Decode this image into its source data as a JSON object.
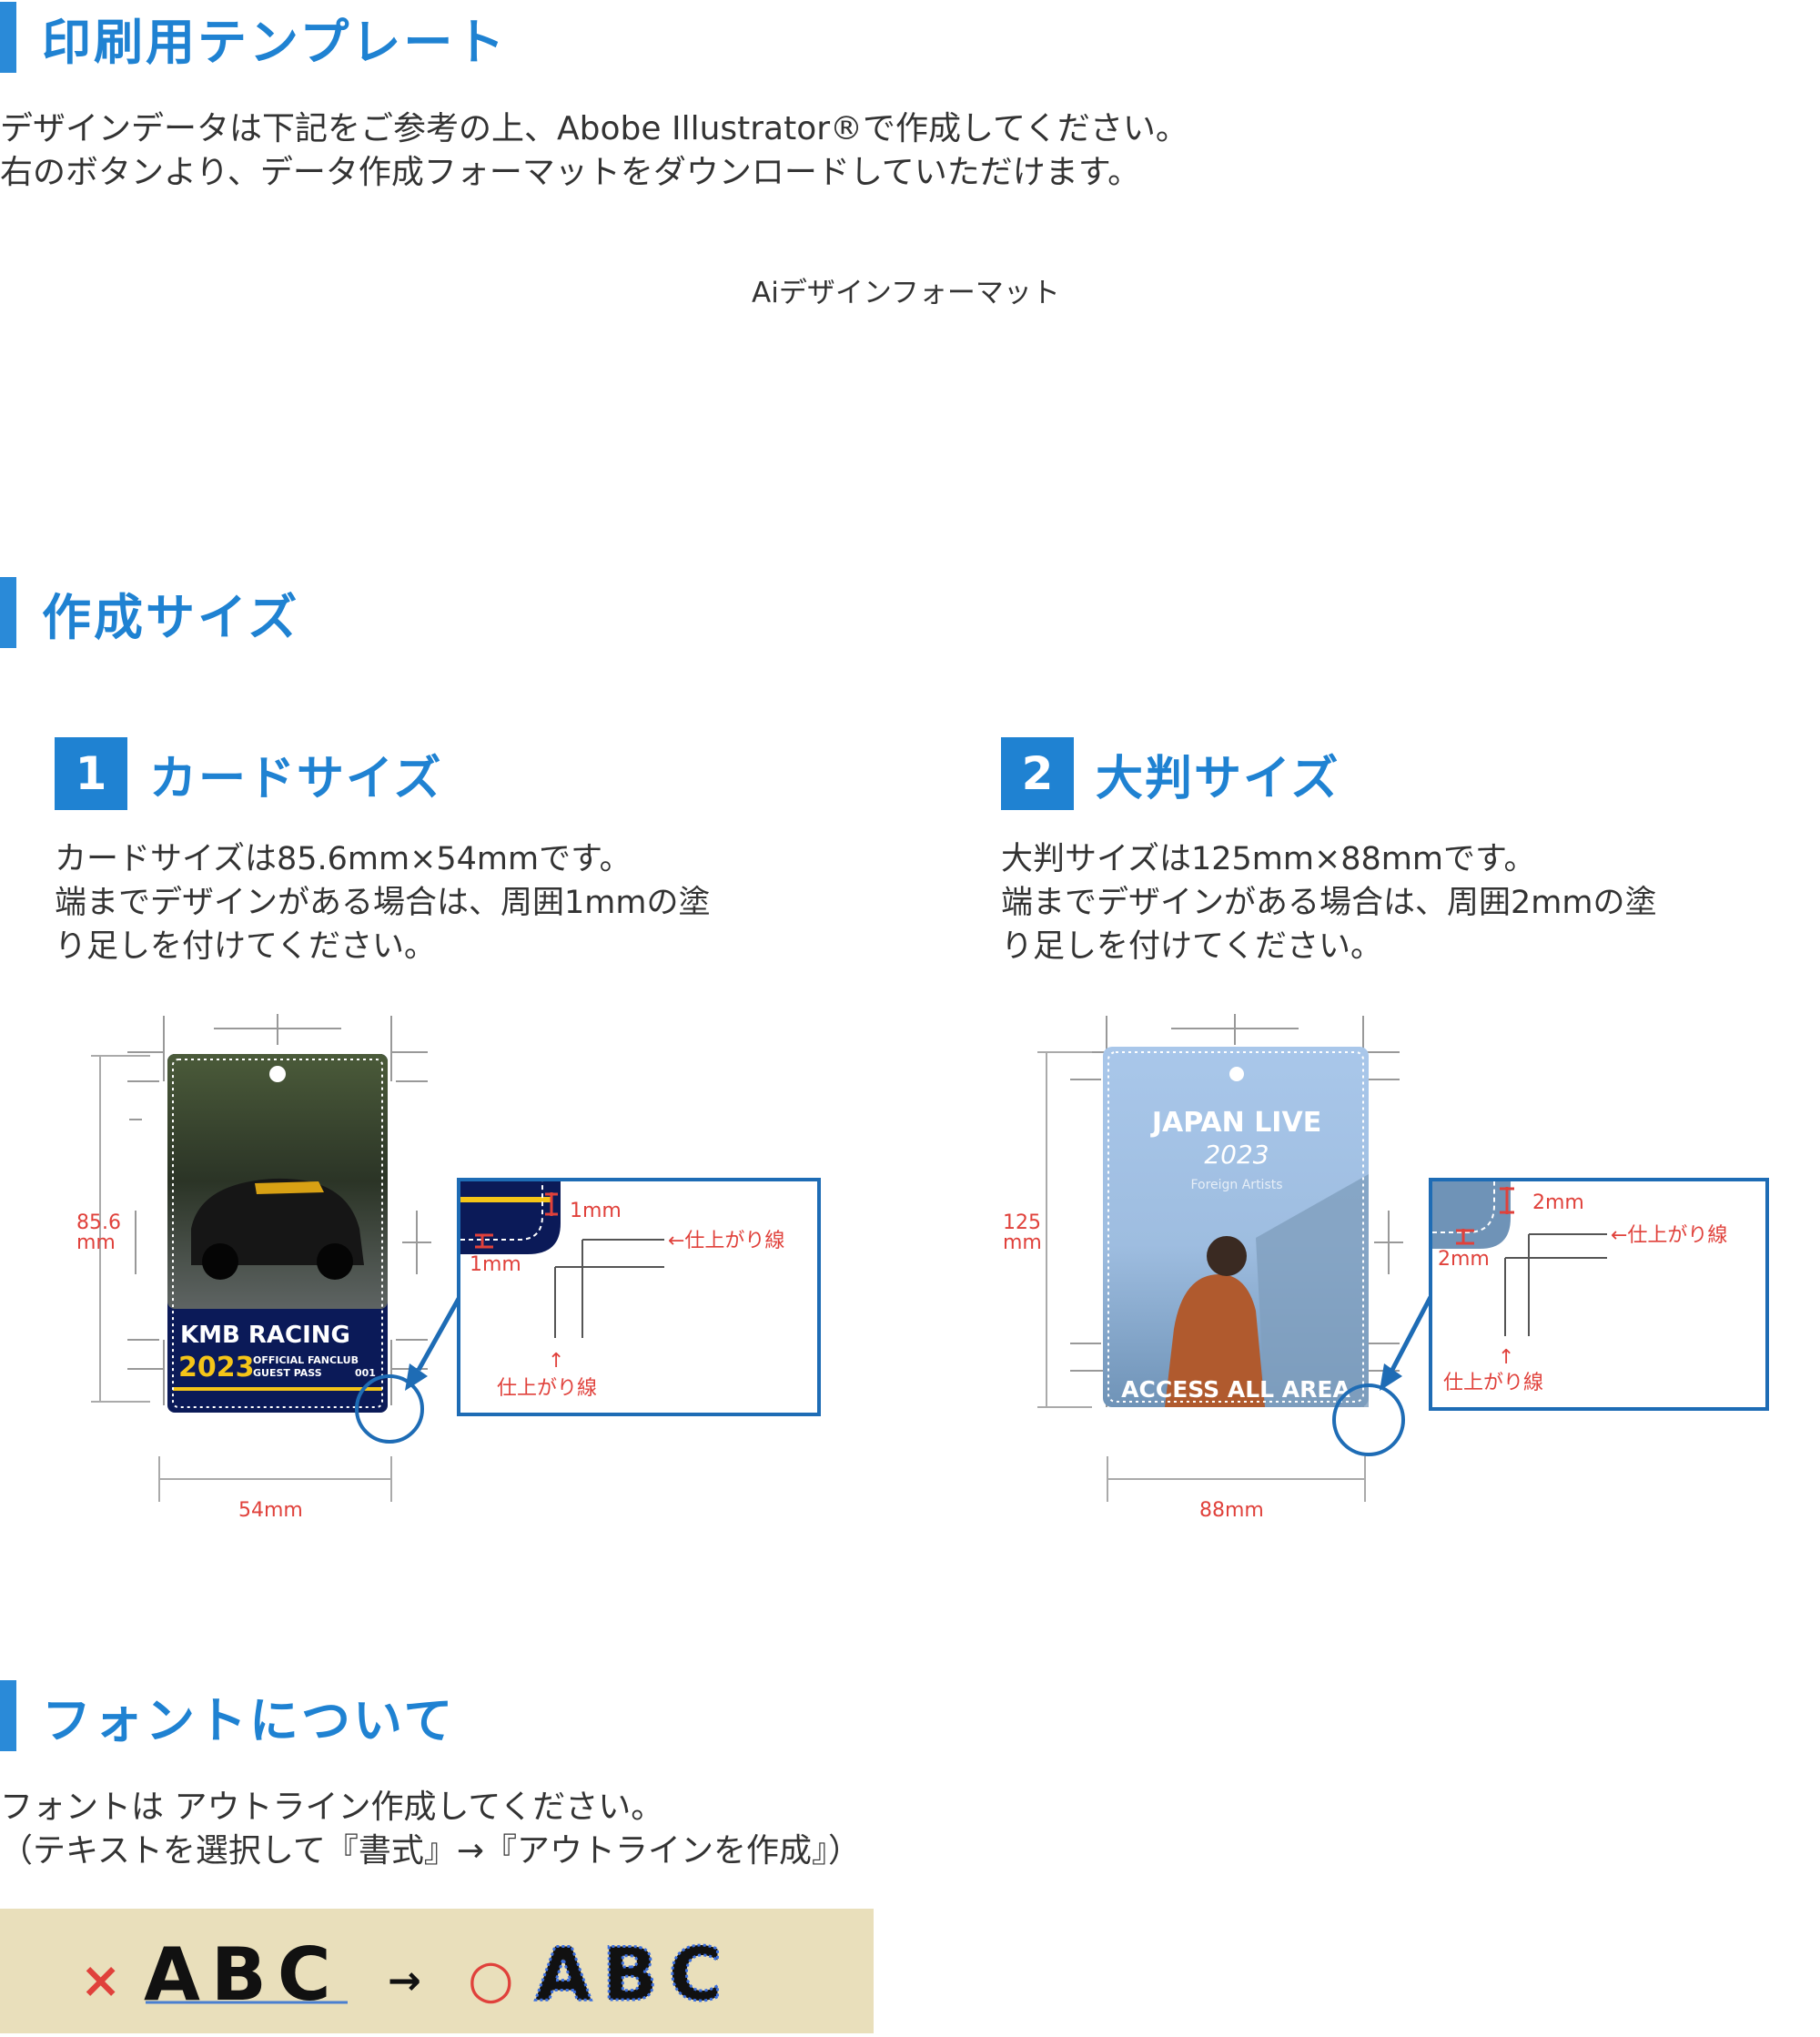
{
  "section_template": {
    "title": "印刷用テンプレート",
    "line1": "デザインデータは下記をご参考の上、Abobe Illustrator®で作成してください。",
    "line2": "右のボタンより、データ作成フォーマットをダウンロードしていただけます。",
    "download_label": "Aiデザインフォーマット"
  },
  "section_size": {
    "title": "作成サイズ",
    "card": {
      "number": "1",
      "title": "カードサイズ",
      "desc1": "カードサイズは85.6mm×54mmです。",
      "desc2": "端までデザインがある場合は、周囲1mmの塗",
      "desc3": "り足しを付けてください。",
      "height_label": "85.6",
      "height_unit": "mm",
      "width_label": "54mm",
      "card_title": "KMB RACING",
      "card_year": "2023",
      "card_sub1": "OFFICIAL FANCLUB",
      "card_sub2": "GUEST PASS",
      "card_num": "001",
      "bleed_label": "1mm",
      "finish_line": "←仕上がり線",
      "finish_arrow": "↑",
      "finish_line2": "仕上がり線"
    },
    "large": {
      "number": "2",
      "title": "大判サイズ",
      "desc1": "大判サイズは125mm×88mmです。",
      "desc2": "端までデザインがある場合は、周囲2mmの塗",
      "desc3": "り足しを付けてください。",
      "height_label": "125",
      "height_unit": "mm",
      "width_label": "88mm",
      "card_title": "JAPAN LIVE",
      "card_year": "2023",
      "card_sub": "Foreign Artists",
      "card_bottom": "ACCESS ALL AREA",
      "bleed_label": "2mm",
      "finish_line": "←仕上がり線",
      "finish_arrow": "↑",
      "finish_line2": "仕上がり線"
    }
  },
  "section_font": {
    "title": "フォントについて",
    "line1": "フォントは アウトライン作成してください。",
    "line2": "（テキストを選択して『書式』→『アウトラインを作成』）",
    "bad_mark": "×",
    "arrow": "→",
    "good_mark": "○",
    "sample_text": "ABC"
  },
  "colors": {
    "accent_blue": "#1f82d2",
    "dimension_red": "#e0413b",
    "callout_border": "#1e6cb5",
    "example_bg": "#e9dfbb"
  }
}
